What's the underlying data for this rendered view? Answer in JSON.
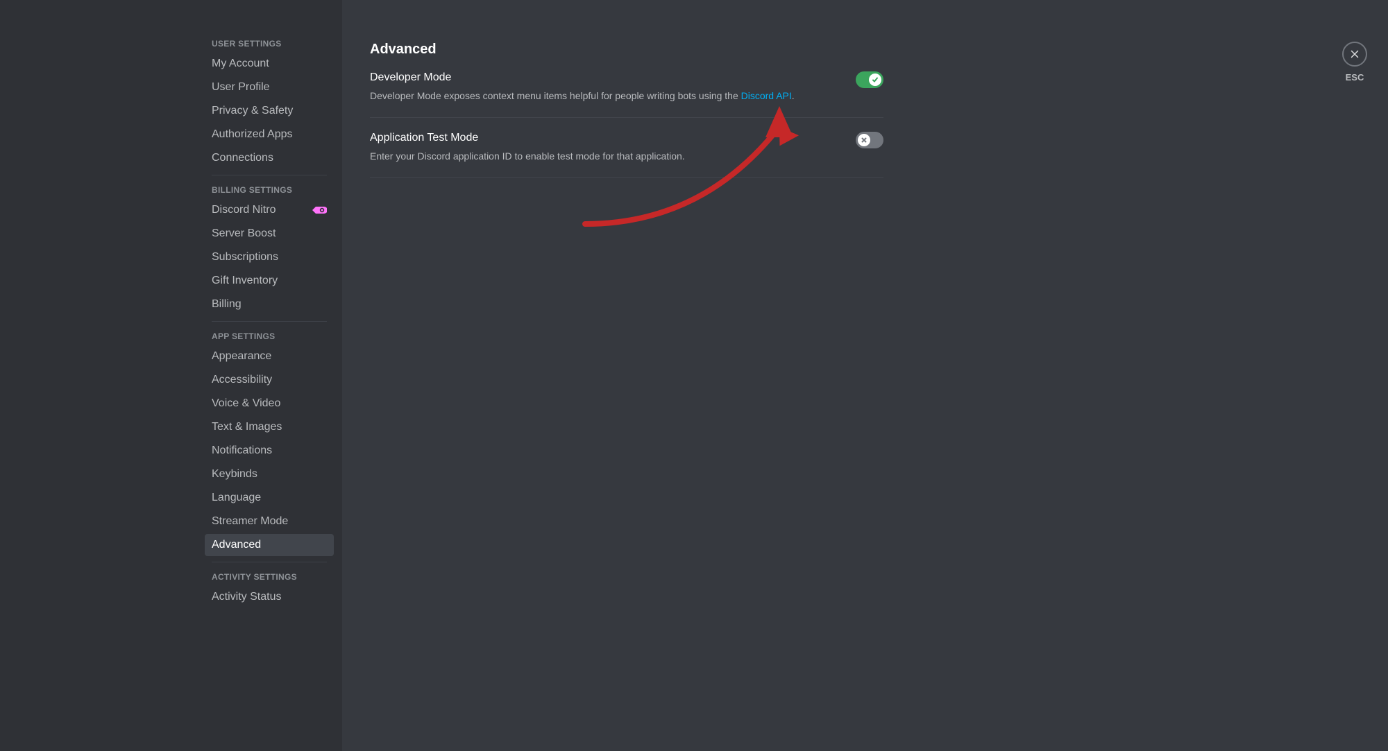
{
  "sidebar": {
    "sections": [
      {
        "header": "USER SETTINGS",
        "items": [
          {
            "key": "my-account",
            "label": "My Account"
          },
          {
            "key": "user-profile",
            "label": "User Profile"
          },
          {
            "key": "privacy-safety",
            "label": "Privacy & Safety"
          },
          {
            "key": "authorized-apps",
            "label": "Authorized Apps"
          },
          {
            "key": "connections",
            "label": "Connections"
          }
        ]
      },
      {
        "header": "BILLING SETTINGS",
        "items": [
          {
            "key": "discord-nitro",
            "label": "Discord Nitro",
            "badge": "nitro"
          },
          {
            "key": "server-boost",
            "label": "Server Boost"
          },
          {
            "key": "subscriptions",
            "label": "Subscriptions"
          },
          {
            "key": "gift-inventory",
            "label": "Gift Inventory"
          },
          {
            "key": "billing",
            "label": "Billing"
          }
        ]
      },
      {
        "header": "APP SETTINGS",
        "items": [
          {
            "key": "appearance",
            "label": "Appearance"
          },
          {
            "key": "accessibility",
            "label": "Accessibility"
          },
          {
            "key": "voice-video",
            "label": "Voice & Video"
          },
          {
            "key": "text-images",
            "label": "Text & Images"
          },
          {
            "key": "notifications",
            "label": "Notifications"
          },
          {
            "key": "keybinds",
            "label": "Keybinds"
          },
          {
            "key": "language",
            "label": "Language"
          },
          {
            "key": "streamer-mode",
            "label": "Streamer Mode"
          },
          {
            "key": "advanced",
            "label": "Advanced",
            "selected": true
          }
        ]
      },
      {
        "header": "ACTIVITY SETTINGS",
        "items": [
          {
            "key": "activity-status",
            "label": "Activity Status"
          }
        ]
      }
    ]
  },
  "close": {
    "esc_label": "ESC"
  },
  "page": {
    "title": "Advanced",
    "settings": {
      "developer_mode": {
        "title": "Developer Mode",
        "desc_prefix": "Developer Mode exposes context menu items helpful for people writing bots using the ",
        "desc_link": "Discord API",
        "desc_suffix": ".",
        "enabled": true
      },
      "app_test_mode": {
        "title": "Application Test Mode",
        "desc": "Enter your Discord application ID to enable test mode for that application.",
        "enabled": false
      }
    }
  },
  "colors": {
    "accent_green": "#3ba55d",
    "link_blue": "#00aff4",
    "nitro_pink": "#ff73fa",
    "annotation_red": "#c62828"
  }
}
